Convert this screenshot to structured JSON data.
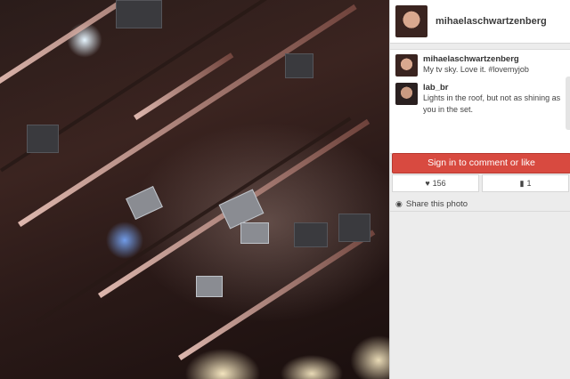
{
  "owner": {
    "username": "mihaelaschwartzenberg"
  },
  "comments": [
    {
      "username": "mihaelaschwartzenberg",
      "text": "My tv sky. Love it. #lovemyjob"
    },
    {
      "username": "lab_br",
      "text": "Lights in the roof, but not as shining as you in the set."
    }
  ],
  "actions": {
    "signin_label": "Sign in to comment or like"
  },
  "stats": {
    "likes": "156",
    "comments": "1"
  },
  "share": {
    "label": "Share this photo"
  },
  "icons": {
    "heart": "heart-icon",
    "comment": "comment-icon",
    "share": "globe-icon"
  },
  "colors": {
    "signin_bg": "#d84a40"
  }
}
